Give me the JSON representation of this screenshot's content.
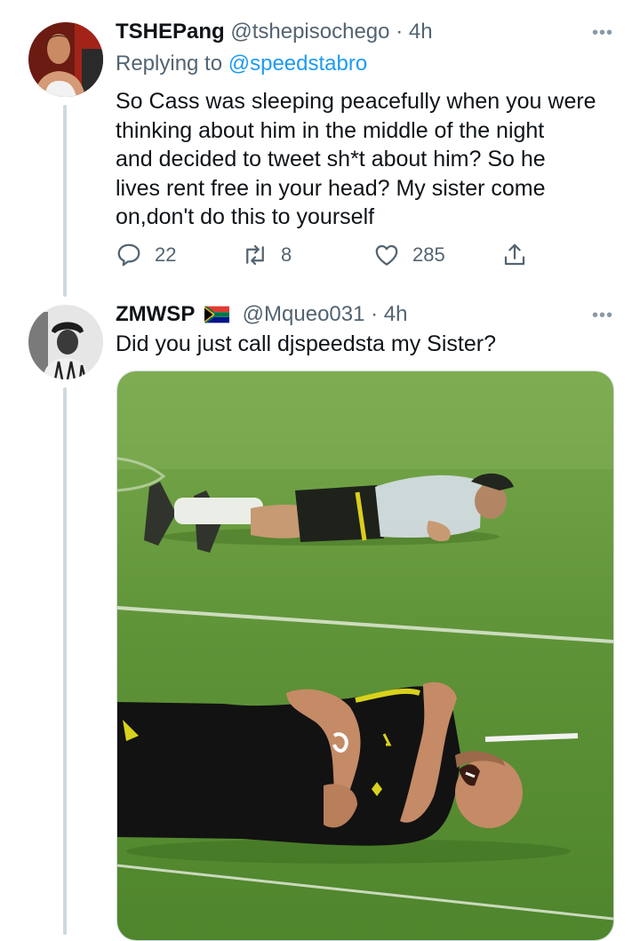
{
  "tweets": [
    {
      "name": "TSHEPang",
      "handle": "@tshepisochego",
      "time": "· 4h",
      "replying_label": "Replying to",
      "replying_to": "@speedstabro",
      "lines": [
        "So Cass was sleeping peacefully when you were",
        "thinking about him in the middle of the night",
        "and decided to tweet sh*t about him? So he",
        "lives rent free in your head? My sister come",
        "on,don't do this to yourself"
      ],
      "stats": {
        "replies": "22",
        "retweets": "8",
        "likes": "285"
      }
    },
    {
      "name": "ZMWSP",
      "handle": "@Mqueo031",
      "time": "· 4h",
      "text": "Did you just call djspeedsta my Sister?",
      "flag": "south-africa-flag-icon"
    }
  ],
  "more_icon": "•••",
  "colors": {
    "accent": "#1d9bf0",
    "secondary_text": "#536471",
    "pitch_green": "#5e9237",
    "thread_line": "#cfd9de"
  },
  "icons": [
    "reply-icon",
    "retweet-icon",
    "like-icon",
    "share-icon",
    "more-icon"
  ]
}
